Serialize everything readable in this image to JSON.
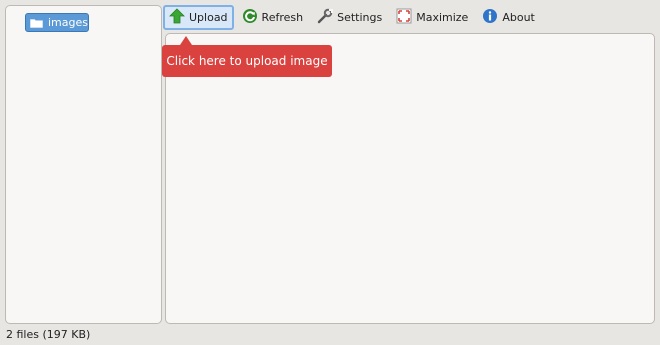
{
  "sidebar": {
    "folders": [
      {
        "label": "images",
        "icon": "folder-icon"
      }
    ]
  },
  "toolbar": {
    "upload_label": "Upload",
    "refresh_label": "Refresh",
    "settings_label": "Settings",
    "maximize_label": "Maximize",
    "about_label": "About"
  },
  "tooltip": {
    "text": "Click here to upload image"
  },
  "status": {
    "text": "2 files (197 KB)"
  },
  "colors": {
    "accent": "#5b9ad6",
    "tooltip_bg": "#d9423f",
    "upload_green": "#3aa635",
    "about_blue": "#2f74c9"
  }
}
